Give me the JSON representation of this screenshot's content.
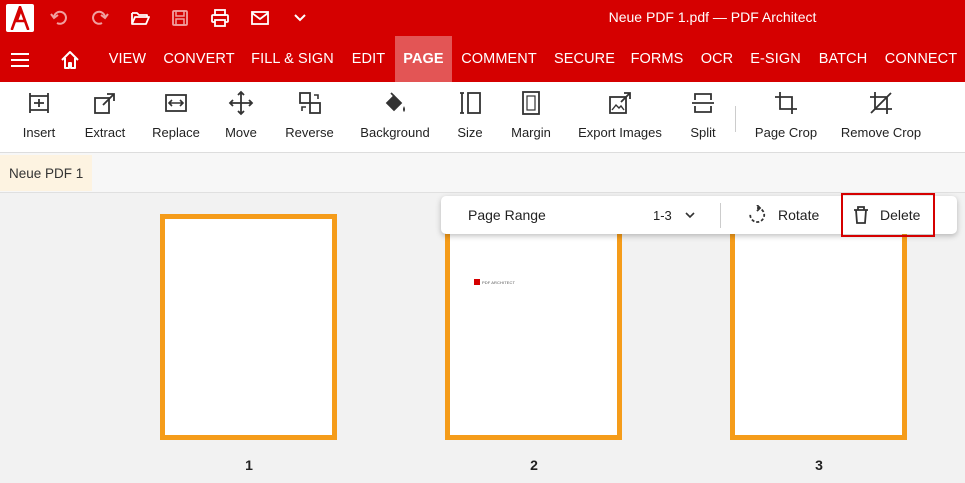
{
  "titlebar": {
    "title": "Neue PDF 1.pdf   —   PDF Architect",
    "quick_access": [
      "undo-icon",
      "redo-icon",
      "open-folder-icon",
      "save-icon",
      "print-icon",
      "email-icon",
      "chevron-down-icon"
    ]
  },
  "menu": {
    "items": [
      "VIEW",
      "CONVERT",
      "FILL & SIGN",
      "EDIT",
      "PAGE",
      "COMMENT",
      "SECURE",
      "FORMS",
      "OCR",
      "E-SIGN",
      "BATCH",
      "CONNECT"
    ],
    "active": "PAGE"
  },
  "ribbon": {
    "tools": [
      "Insert",
      "Extract",
      "Replace",
      "Move",
      "Reverse",
      "Background",
      "Size",
      "Margin",
      "Export Images",
      "Split",
      "Page Crop",
      "Remove Crop"
    ]
  },
  "document_tab": {
    "label": "Neue PDF 1"
  },
  "pages": [
    {
      "number": "1"
    },
    {
      "number": "2",
      "logo_text": "PDF ARCHITECT"
    },
    {
      "number": "3"
    }
  ],
  "floating_toolbar": {
    "page_range_label": "Page Range",
    "page_range_value": "1-3",
    "rotate_label": "Rotate",
    "delete_label": "Delete"
  },
  "colors": {
    "brand_red": "#d50000",
    "active_tab": "#e35555",
    "page_border": "#f59c1a"
  }
}
